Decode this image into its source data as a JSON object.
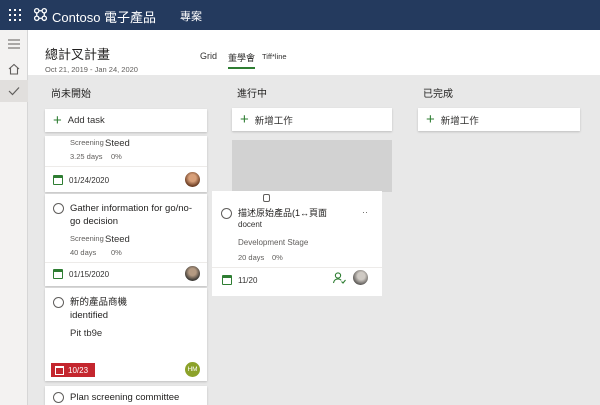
{
  "app": {
    "brand": "Contoso 電子產品",
    "nav_link": "專案",
    "icons": [
      "waffle-icon",
      "contoso-logo-icon",
      "hamburger-icon",
      "home-icon",
      "check-icon"
    ]
  },
  "plan": {
    "title": "總計叉計畫",
    "dates": "Oct 21, 2019 - Jan 24, 2020",
    "views": [
      "Grid",
      "董學會",
      "Tiff*line"
    ],
    "active_view": "董學會"
  },
  "buckets": [
    {
      "name": "尚未開始",
      "add_label": "Add task"
    },
    {
      "name": "進行中",
      "add_label": "新增工作"
    },
    {
      "name": "已完成",
      "add_label": "新增工作"
    }
  ],
  "not_started": {
    "card1": {
      "label": "Screening",
      "owner": "Steed",
      "duration": "3.25 days",
      "progress": "0%",
      "date": "01/24/2020"
    },
    "card2": {
      "title": "Gather information for go/no-go decision",
      "label": "Screening",
      "owner": "Steed",
      "duration": "40 days",
      "progress": "0%",
      "date": "01/15/2020"
    },
    "card3": {
      "title": "新的產品商機",
      "subtitle": "identified",
      "owner": "Pit tb9e",
      "date": "10/23",
      "initials": "HM"
    },
    "card4": {
      "title": "Plan screening committee"
    }
  },
  "in_progress": {
    "card1": {
      "title": "描述原始產品(1↔頁面",
      "subtitle": "docent",
      "more": "··",
      "stage": "Development Stage",
      "duration": "20 days",
      "progress": "0%",
      "checklist": "11/20",
      "attachment_icon": "clip-icon"
    }
  },
  "colors": {
    "topbar": "#243a5e",
    "accent": "#2e7d32",
    "overdue": "#c4262e",
    "board": "#e8e8e8"
  }
}
